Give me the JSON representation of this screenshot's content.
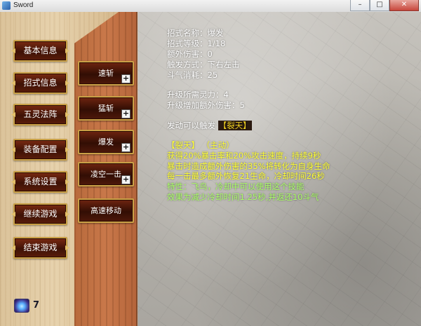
{
  "window": {
    "title": "Sword",
    "minimize": "–",
    "maximize": "□",
    "close": "✕"
  },
  "menu": [
    "基本信息",
    "招式信息",
    "五灵法阵",
    "装备配置",
    "系统设置",
    "继续游戏",
    "结束游戏"
  ],
  "skills": [
    "速斩",
    "猛斩",
    "爆发",
    "凌空一击",
    "高速移动"
  ],
  "skill_plus": "+",
  "detail": {
    "name": "招式名称：爆发",
    "level": "招式等级：1/18",
    "extra_damage": "额外伤害：0",
    "trigger": "触发方式：下右左击",
    "cost": "斗气消耗：25",
    "upgrade_power": "升级所需灵力：4",
    "upgrade_damage": "升级增加额外伤害：5",
    "can_trigger_label": "发动可以触发",
    "can_trigger_skill": "【裂天】"
  },
  "linked_skill": {
    "header_name": "【裂天】",
    "header_type": "（主动）",
    "line1": "获得20%暴击率和20%攻击速度，持续9秒",
    "line2": "暴击时造成额外伤害的35%将转化为自身生命",
    "line3": "每一击最多额外恢复21生命，冷却时间26秒",
    "line4": "特性：飞鸟，冷却中可以使用这个技能",
    "line5": "效果为减少冷却时间1.25秒,并返还10斗气"
  },
  "inventory": {
    "gem_count": "7"
  },
  "colors": {
    "accent_gold": "#caa046",
    "highlight_yellow": "#ffff33",
    "highlight_green": "#aaff66"
  }
}
